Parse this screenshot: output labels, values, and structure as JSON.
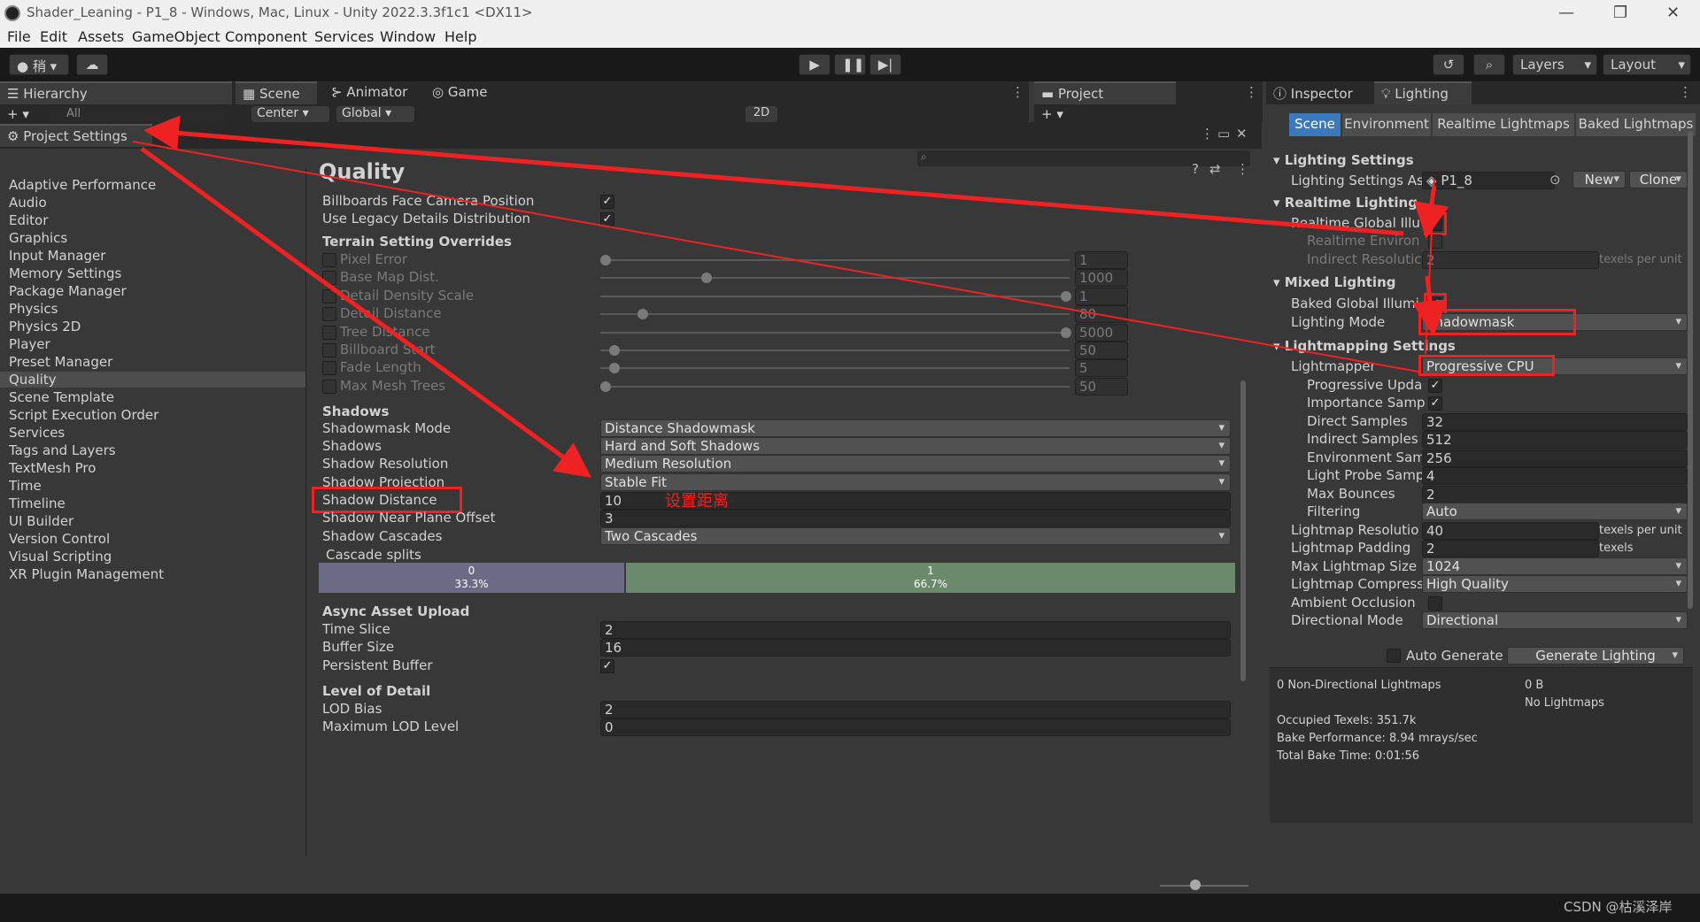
{
  "window": {
    "title": "Shader_Leaning - P1_8 - Windows, Mac, Linux - Unity 2022.3.3f1c1 <DX11>"
  },
  "menu": [
    "File",
    "Edit",
    "Assets",
    "GameObject",
    "Component",
    "Services",
    "Window",
    "Help"
  ],
  "toolbar": {
    "account": "稍 ▾",
    "layers": "Layers",
    "layout": "Layout"
  },
  "tabs": {
    "hierarchy": "Hierarchy",
    "scene": "Scene",
    "animator": "Animator",
    "game": "Game",
    "project": "Project",
    "inspector": "Inspector",
    "lighting": "Lighting"
  },
  "hierarchy": {
    "search_placeholder": "All"
  },
  "scene": {
    "pivot": "Center",
    "space": "Global",
    "mode2d": "2D"
  },
  "project_settings": {
    "title": "Project Settings",
    "items": [
      "Adaptive Performance",
      "Audio",
      "Editor",
      "Graphics",
      "Input Manager",
      "Memory Settings",
      "Package Manager",
      "Physics",
      "Physics 2D",
      "Player",
      "Preset Manager",
      "Quality",
      "Scene Template",
      "Script Execution Order",
      "Services",
      "Tags and Layers",
      "TextMesh Pro",
      "Time",
      "Timeline",
      "UI Builder",
      "Version Control",
      "Visual Scripting",
      "XR Plugin Management"
    ],
    "selected": "Quality"
  },
  "quality": {
    "title": "Quality",
    "billboards_face": "Billboards Face Camera Position",
    "use_legacy": "Use Legacy Details Distribution",
    "terrain_header": "Terrain Setting Overrides",
    "terrain": [
      {
        "label": "Pixel Error",
        "value": "1",
        "pos": 0.0
      },
      {
        "label": "Base Map Dist.",
        "value": "1000",
        "pos": 0.22
      },
      {
        "label": "Detail Density Scale",
        "value": "1",
        "pos": 1.0
      },
      {
        "label": "Detail Distance",
        "value": "80",
        "pos": 0.08
      },
      {
        "label": "Tree Distance",
        "value": "5000",
        "pos": 1.0
      },
      {
        "label": "Billboard Start",
        "value": "50",
        "pos": 0.02
      },
      {
        "label": "Fade Length",
        "value": "5",
        "pos": 0.02
      },
      {
        "label": "Max Mesh Trees",
        "value": "50",
        "pos": 0.0
      }
    ],
    "shadows_header": "Shadows",
    "shadowmask_mode_label": "Shadowmask Mode",
    "shadowmask_mode": "Distance Shadowmask",
    "shadows_label": "Shadows",
    "shadows": "Hard and Soft Shadows",
    "shadow_resolution_label": "Shadow Resolution",
    "shadow_resolution": "Medium Resolution",
    "shadow_projection_label": "Shadow Projection",
    "shadow_projection": "Stable Fit",
    "shadow_distance_label": "Shadow Distance",
    "shadow_distance": "10",
    "annotation": "设置距离",
    "near_plane_label": "Shadow Near Plane Offset",
    "near_plane": "3",
    "cascades_label": "Shadow Cascades",
    "cascades": "Two Cascades",
    "cascade_splits_label": "Cascade splits",
    "cascade0": {
      "index": "0",
      "percent": "33.3%"
    },
    "cascade1": {
      "index": "1",
      "percent": "66.7%"
    },
    "async_header": "Async Asset Upload",
    "time_slice_label": "Time Slice",
    "time_slice": "2",
    "buffer_size_label": "Buffer Size",
    "buffer_size": "16",
    "persistent_label": "Persistent Buffer",
    "lod_header": "Level of Detail",
    "lod_bias_label": "LOD Bias",
    "lod_bias": "2",
    "max_lod_label": "Maximum LOD Level",
    "max_lod": "0"
  },
  "lighting": {
    "tabs": [
      "Scene",
      "Environment",
      "Realtime Lightmaps",
      "Baked Lightmaps"
    ],
    "settings_header": "Lighting Settings",
    "settings_asset_label": "Lighting Settings As",
    "settings_asset": "P1_8",
    "new": "New",
    "clone": "Clone",
    "realtime_header": "Realtime Lighting",
    "realtime_gi": "Realtime Global Illu",
    "realtime_env": "Realtime Environ",
    "indirect_res": "Indirect Resolutic",
    "indirect_res_value": "2",
    "texels_per_unit": "texels per unit",
    "mixed_header": "Mixed Lighting",
    "baked_gi": "Baked Global Illumi",
    "lighting_mode_label": "Lighting Mode",
    "lighting_mode": "Shadowmask",
    "lightmapping_header": "Lightmapping Settings",
    "lightmapper_label": "Lightmapper",
    "lightmapper": "Progressive CPU",
    "prog_updates": "Progressive Upda",
    "importance": "Importance Samp",
    "direct_samples_label": "Direct Samples",
    "direct_samples": "32",
    "indirect_samples_label": "Indirect Samples",
    "indirect_samples": "512",
    "env_samples_label": "Environment Sam",
    "env_samples": "256",
    "probe_samples_label": "Light Probe Samp",
    "probe_samples": "4",
    "max_bounces_label": "Max Bounces",
    "max_bounces": "2",
    "filtering_label": "Filtering",
    "filtering": "Auto",
    "lm_res_label": "Lightmap Resolutio",
    "lm_res": "40",
    "lm_pad_label": "Lightmap Padding",
    "lm_pad": "2",
    "texels": "texels",
    "max_lm_label": "Max Lightmap Size",
    "max_lm": "1024",
    "compress_label": "Lightmap Compress",
    "compress": "High Quality",
    "ao_label": "Ambient Occlusion",
    "dir_mode_label": "Directional Mode",
    "dir_mode": "Directional",
    "auto_generate": "Auto Generate",
    "generate": "Generate Lighting",
    "stats": {
      "non_dir": "0 Non-Directional Lightmaps",
      "size": "0 B",
      "no_lightmaps": "No Lightmaps",
      "occupied": "Occupied Texels: 351.7k",
      "bake_perf": "Bake Performance: 8.94 mrays/sec",
      "bake_time": "Total Bake Time: 0:01:56"
    }
  },
  "watermark": "CSDN @枯溪泽岸"
}
